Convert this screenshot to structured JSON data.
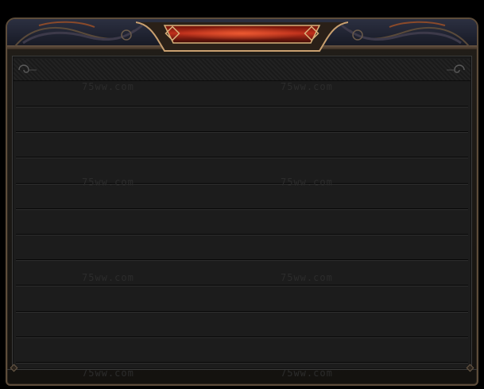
{
  "window": {
    "title": "",
    "colors": {
      "frame_border": "#5d4c3a",
      "header_band": "#2c3041",
      "title_plate_red": "#c0301c",
      "title_plate_gold": "#c9a070",
      "content_bg": "#1c1c1c",
      "row_divider": "#2e2e2e",
      "watermark": "#2c2c2c"
    }
  },
  "ornaments": {
    "left": "scroll-ornament-icon",
    "right": "scroll-ornament-icon",
    "corner_left": "swirl-icon",
    "corner_right": "swirl-icon"
  },
  "list": {
    "row_count": 11
  },
  "watermarks": [
    "75ww.com",
    "75ww.com",
    "75ww.com",
    "75ww.com",
    "75ww.com",
    "75ww.com",
    "75ww.com",
    "75ww.com"
  ]
}
